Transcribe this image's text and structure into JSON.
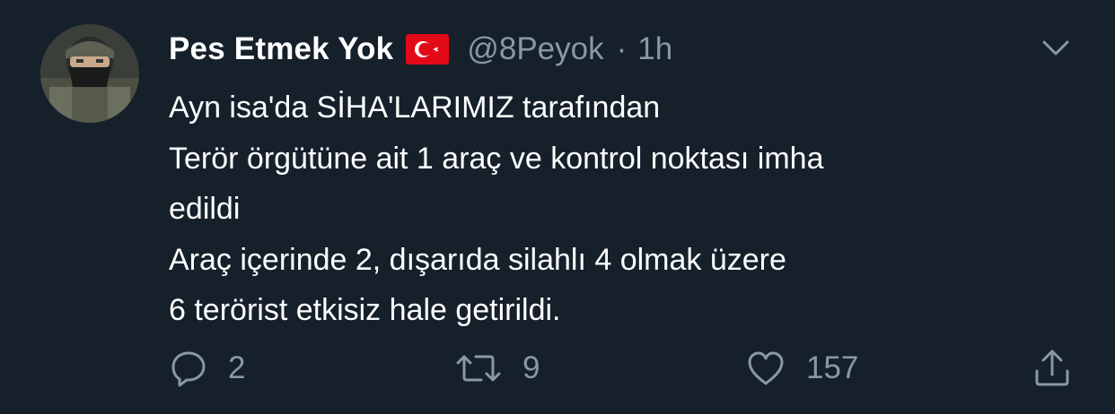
{
  "tweet": {
    "display_name": "Pes Etmek Yok",
    "handle": "@8Peyok",
    "separator": "·",
    "time": "1h",
    "flag_icon": "turkey-flag-icon",
    "text_lines": [
      "Ayn isa'da SİHA'LARIMIZ tarafından",
      "Terör örgütüne ait 1 araç ve kontrol noktası imha",
      "edildi",
      "Araç içerinde 2, dışarıda silahlı 4 olmak üzere",
      "6 terörist etkisiz hale getirildi."
    ]
  },
  "actions": {
    "reply": {
      "icon": "reply-icon",
      "count": "2"
    },
    "retweet": {
      "icon": "retweet-icon",
      "count": "9"
    },
    "like": {
      "icon": "heart-icon",
      "count": "157"
    },
    "share": {
      "icon": "share-icon"
    }
  },
  "colors": {
    "background": "#15202b",
    "primary_text": "#ffffff",
    "secondary_text": "#8899a6",
    "flag_red": "#e30a17"
  }
}
